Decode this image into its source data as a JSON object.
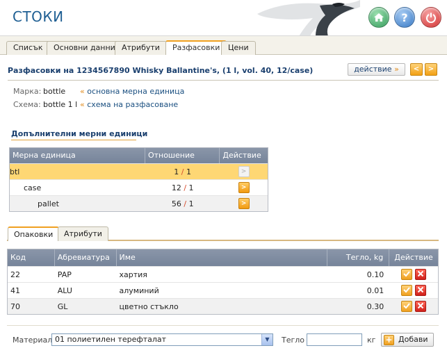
{
  "header": {
    "title": "СТОКИ",
    "buttons": {
      "home": "home",
      "help": "?",
      "power": "power"
    }
  },
  "tabs": [
    {
      "label": "Списък",
      "active": false
    },
    {
      "label": "Основни данни",
      "active": false
    },
    {
      "label": "Атрибути",
      "active": false
    },
    {
      "label": "Разфасовки",
      "active": true
    },
    {
      "label": "Цени",
      "active": false
    }
  ],
  "page": {
    "title": "Разфасовки на 1234567890 Whisky Ballantine's, (1 l, vol. 40, 12/case)",
    "action_label": "действие",
    "action_arrow": "»",
    "prev": "<",
    "next": ">"
  },
  "info": {
    "brand_label": "Марка:",
    "brand_value": "bottle",
    "brand_link": "основна мерна единица",
    "scheme_label": "Схема:",
    "scheme_value": "bottle 1 l",
    "scheme_link": "схема на разфасоване",
    "link_mark": "«"
  },
  "units": {
    "section_title": "Допълнителни мерни единици",
    "headers": {
      "unit": "Мерна единица",
      "ratio": "Отношение",
      "action": "Действие"
    },
    "rows": [
      {
        "unit": "btl",
        "num": "1",
        "den": "1",
        "sep": "/"
      },
      {
        "unit": "case",
        "num": "12",
        "den": "1",
        "sep": "/"
      },
      {
        "unit": "pallet",
        "num": "56",
        "den": "1",
        "sep": "/"
      }
    ]
  },
  "subtabs": [
    {
      "label": "Опаковки",
      "active": true
    },
    {
      "label": "Атрибути",
      "active": false
    }
  ],
  "packaging": {
    "headers": {
      "code": "Код",
      "abbr": "Абревиатура",
      "name": "Име",
      "weight": "Тегло, kg",
      "action": "Действие"
    },
    "rows": [
      {
        "code": "22",
        "abbr": "PAP",
        "name": "хартия",
        "weight": "0.10"
      },
      {
        "code": "41",
        "abbr": "ALU",
        "name": "алуминий",
        "weight": "0.01"
      },
      {
        "code": "70",
        "abbr": "GL",
        "name": "цветно стъкло",
        "weight": "0.30"
      }
    ]
  },
  "form": {
    "material_label": "Материал",
    "material_value": "01 полиетилен терефталат",
    "weight_label": "Тегло",
    "weight_value": "",
    "unit_label": "кг",
    "add_label": "Добави"
  },
  "colors": {
    "accent": "#f0a020",
    "title_blue": "#1a3f6e",
    "selected_row": "#fed774",
    "table_header": "#7f8ca1"
  }
}
